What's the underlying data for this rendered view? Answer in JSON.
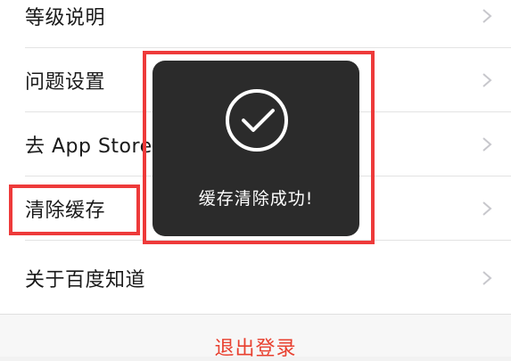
{
  "settings": {
    "items": [
      {
        "label": "等级说明",
        "icon": "chevron-right-icon"
      },
      {
        "label": "问题设置",
        "icon": "chevron-right-icon"
      },
      {
        "label": "去 App Store 评价",
        "icon": "chevron-right-icon"
      },
      {
        "label": "清除缓存",
        "icon": "chevron-right-icon"
      },
      {
        "label": "关于百度知道",
        "icon": "chevron-right-icon"
      }
    ]
  },
  "logout": {
    "label": "退出登录"
  },
  "toast": {
    "icon": "checkmark-circle-icon",
    "message": "缓存清除成功!"
  },
  "colors": {
    "background": "#f2f2f2",
    "list_background": "#ffffff",
    "text": "#1a1a1a",
    "chevron": "#c7c7cc",
    "logout_text": "#e8402f",
    "toast_background": "#2b2b2b",
    "highlight": "#ee3a3a"
  }
}
